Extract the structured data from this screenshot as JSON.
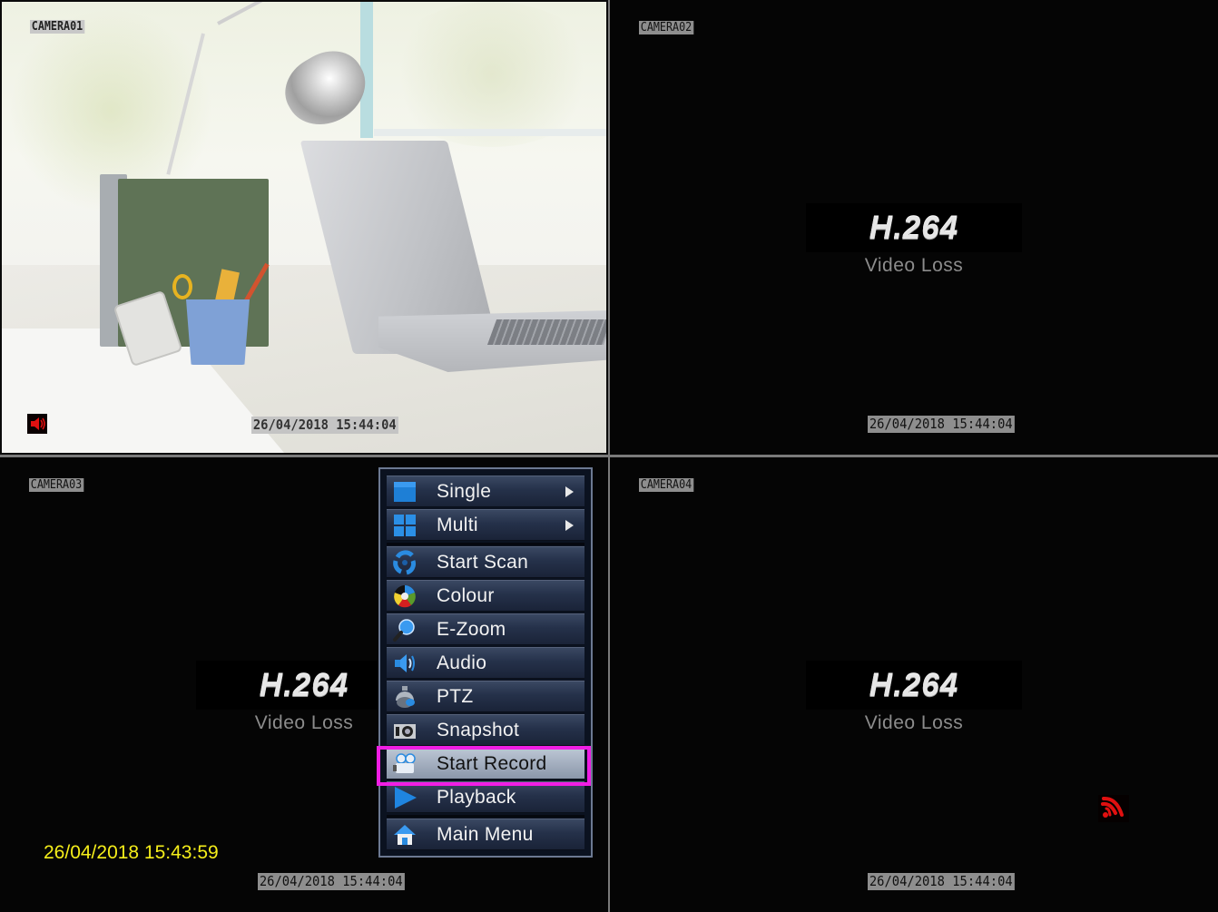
{
  "cameras": [
    {
      "label": "CAMERA01",
      "timestamp": "26/04/2018 15:44:04",
      "status": "live",
      "audio_icon": "speaker-icon"
    },
    {
      "label": "CAMERA02",
      "timestamp": "26/04/2018 15:44:04",
      "status": "video-loss",
      "codec": "H.264",
      "message": "Video Loss"
    },
    {
      "label": "CAMERA03",
      "timestamp": "26/04/2018 15:44:04",
      "status": "video-loss",
      "codec": "H.264",
      "message": "Video Loss"
    },
    {
      "label": "CAMERA04",
      "timestamp": "26/04/2018 15:44:04",
      "status": "video-loss",
      "codec": "H.264",
      "message": "Video Loss",
      "network_icon": "signal-icon"
    }
  ],
  "system_time": "26/04/2018 15:43:59",
  "context_menu": {
    "items": [
      {
        "label": "Single",
        "icon": "single-view-icon",
        "submenu": true
      },
      {
        "label": "Multi",
        "icon": "multi-view-icon",
        "submenu": true
      },
      {
        "label": "Start Scan",
        "icon": "scan-icon",
        "submenu": false
      },
      {
        "label": "Colour",
        "icon": "colour-icon",
        "submenu": false
      },
      {
        "label": "E-Zoom",
        "icon": "magnifier-icon",
        "submenu": false
      },
      {
        "label": "Audio",
        "icon": "speaker-icon",
        "submenu": false
      },
      {
        "label": "PTZ",
        "icon": "ptz-camera-icon",
        "submenu": false
      },
      {
        "label": "Snapshot",
        "icon": "camera-icon",
        "submenu": false
      },
      {
        "label": "Start Record",
        "icon": "video-camera-icon",
        "submenu": false,
        "highlighted": true
      },
      {
        "label": "Playback",
        "icon": "play-icon",
        "submenu": false
      },
      {
        "label": "Main Menu",
        "icon": "home-icon",
        "submenu": false
      }
    ]
  },
  "colors": {
    "highlight_border": "#f01ee4",
    "system_time": "#f5ee1a",
    "alert_red": "#e01010"
  }
}
